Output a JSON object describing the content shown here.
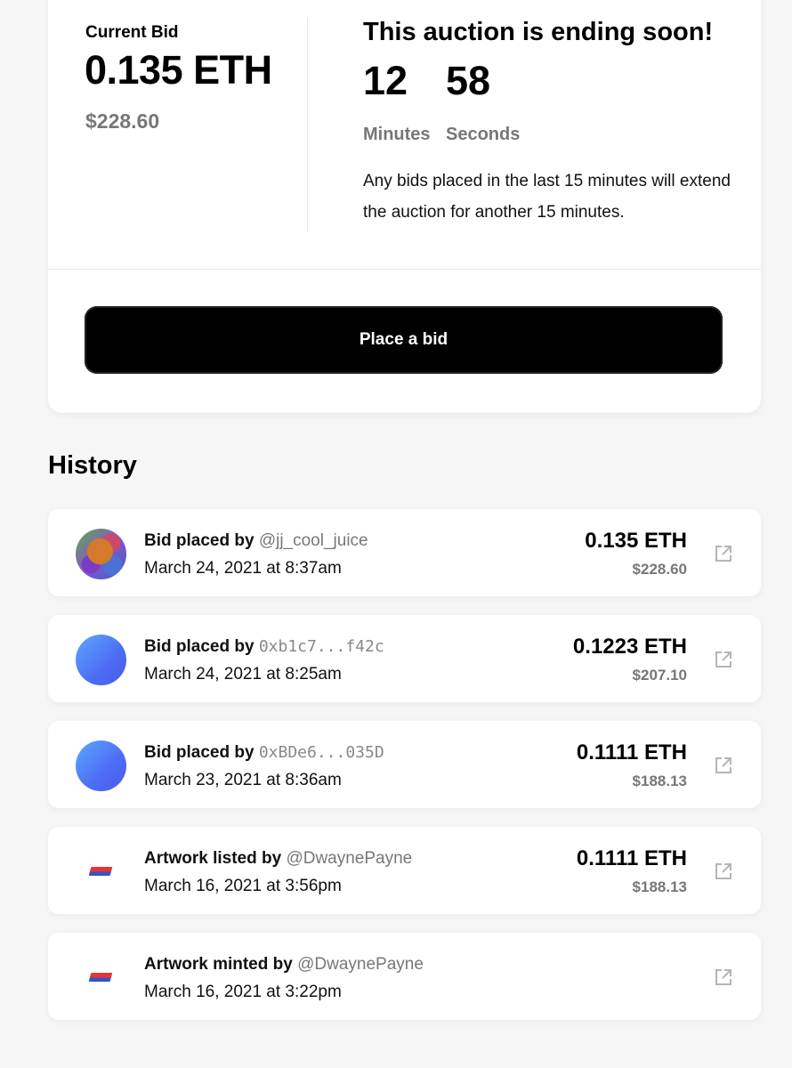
{
  "auction": {
    "current_bid_label": "Current Bid",
    "current_bid_eth": "0.135 ETH",
    "current_bid_usd": "$228.60",
    "ending_title": "This auction is ending soon!",
    "countdown": {
      "minutes_value": "12",
      "minutes_label": "Minutes",
      "seconds_value": "58",
      "seconds_label": "Seconds"
    },
    "extend_note": "Any bids placed in the last 15 minutes will extend the auction for another 15 minutes.",
    "place_bid_label": "Place a bid"
  },
  "history": {
    "title": "History",
    "rows": [
      {
        "avatar": "user-photo",
        "action": "Bid placed by",
        "actor": "@jj_cool_juice",
        "actor_style": "handle",
        "date": "March 24, 2021 at 8:37am",
        "eth": "0.135 ETH",
        "usd": "$228.60",
        "link_icon": "external-link-icon"
      },
      {
        "avatar": "gradient-circle",
        "action": "Bid placed by",
        "actor": "0xb1c7...f42c",
        "actor_style": "address",
        "date": "March 24, 2021 at 8:25am",
        "eth": "0.1223 ETH",
        "usd": "$207.10",
        "link_icon": "external-link-icon"
      },
      {
        "avatar": "gradient-circle",
        "action": "Bid placed by",
        "actor": "0xBDe6...035D",
        "actor_style": "address",
        "date": "March 23, 2021 at 8:36am",
        "eth": "0.1111 ETH",
        "usd": "$188.13",
        "link_icon": "external-link-icon"
      },
      {
        "avatar": "artwork-logo",
        "action": "Artwork listed by",
        "actor": "@DwaynePayne",
        "actor_style": "handle",
        "date": "March 16, 2021 at 3:56pm",
        "eth": "0.1111 ETH",
        "usd": "$188.13",
        "link_icon": "external-link-icon"
      },
      {
        "avatar": "artwork-logo",
        "action": "Artwork minted by",
        "actor": "@DwaynePayne",
        "actor_style": "handle",
        "date": "March 16, 2021 at 3:22pm",
        "eth": "",
        "usd": "",
        "link_icon": "external-link-icon"
      }
    ]
  },
  "colors": {
    "background": "#f6f6f6",
    "card": "#ffffff",
    "button": "#000000",
    "muted_text": "#777777",
    "avatar_gradient_start": "#5da8ff",
    "avatar_gradient_end": "#4a5ae8"
  }
}
